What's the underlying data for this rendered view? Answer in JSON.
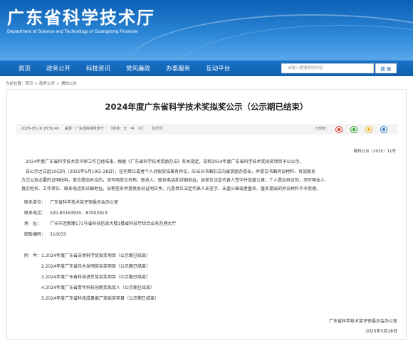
{
  "header": {
    "title": "广东省科学技术厅",
    "subtitle": "Department of Science and Technology of Guangdong Province"
  },
  "nav": {
    "items": [
      "首页",
      "政务公开",
      "科技资讯",
      "党风廉政",
      "办事服务",
      "互动平台"
    ],
    "search_placeholder": "请输入要搜索的内容",
    "search_button": "搜 索"
  },
  "breadcrumb": {
    "prefix": "当前位置：",
    "items": [
      "首页",
      "政务公开",
      "通知公告"
    ],
    "separator": ">"
  },
  "article": {
    "title": "2024年度广东省科学技术奖拟奖公示（公示期已结束）",
    "meta": {
      "date": "2025-05-16 18:50:40",
      "source": "来源：广东省科学技术厅",
      "font": "【字体：大　中　小】",
      "print": "【打印】",
      "share_label": "分享到："
    },
    "doc_no": "粤科公示〔2025〕11号",
    "paragraphs": [
      "2024年度广东省科学技术奖评审工作已经结束。根据《广东省科学技术奖励办法》有关规定，现将2024年度广东省科学技术奖拟奖项目予以公示。",
      "自公示之日起10日内（2025年5月19日-28日），任何单位或者个人对拟奖结果有异议，应当以书面形式向省奖励办提出，并提交书面异议材料、有效联系",
      "方式以及必要的证明材料。单位提出异议的，须写明单位名称、联系人、联系电话和详细地址，由单位法定代表人签字并加盖公章；个人提出异议的，须写明本人",
      "真实姓名、工作单位、联系电话和详细地址，亲笔签名并提供身份证明文件。凡是单位法定代表人未签字、未盖公章或者匿名、匿名提出的异议材料不予受理。"
    ],
    "contacts": [
      {
        "key": "联系单位：",
        "value": "广东省科学技术奖评审委员会办公室"
      },
      {
        "key": "联系电话：",
        "value": "020-83163930、87003913"
      },
      {
        "key": "地　址：",
        "value": "广州市连新路171号省科技信息大楼1楼省科技厅综合业务办理大厅"
      },
      {
        "key": "邮政编码：",
        "value": "510033"
      }
    ],
    "attachments_label": "附　件：",
    "attachments": [
      "1.2024年度广东省自然科学奖拟奖项目（公示期已结束）",
      "2.2024年度广东省技术发明奖拟奖项目（公示期已结束）",
      "3.2024年度广东省科技进步奖拟奖项目（公示期已结束）",
      "4.2024年度广东省青年科技创新奖拟奖人（公示期已结束）",
      "5.2024年度广东省科技成果推广奖拟奖项目（公示期已结束）"
    ],
    "signature": {
      "org": "广东省科学技术奖评审委员会办公室",
      "date": "2025年5月18日"
    }
  },
  "colors": {
    "header_blue": "#0c5fb5",
    "nav_blue": "#0f5fae"
  },
  "icons": [
    "weibo-icon",
    "wechat-icon",
    "qzone-icon",
    "plus-icon"
  ]
}
